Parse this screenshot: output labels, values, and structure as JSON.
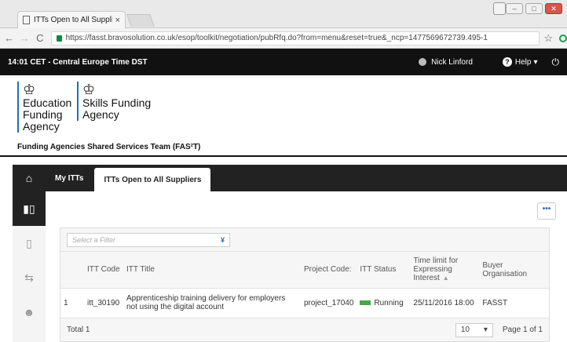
{
  "browser": {
    "tab_title": "ITTs Open to All Supplie",
    "tab_close": "×",
    "url": "https://fasst.bravosolution.co.uk/esop/toolkit/negotiation/pubRfq.do?from=menu&reset=true&_ncp=1477569672739.495-1",
    "back": "←",
    "forward": "→",
    "reload": "C",
    "star": "☆"
  },
  "topbar": {
    "time": "14:01 CET - Central Europe Time DST",
    "user_name": "Nick Linford",
    "help_label": "Help",
    "help_caret": "▾",
    "power": "⏻"
  },
  "header": {
    "logo1": [
      "Education",
      "Funding",
      "Agency"
    ],
    "logo2": [
      "Skills Funding",
      "Agency"
    ],
    "crest": "♔",
    "team_name": "Funding Agencies Shared Services Team (FAS²T)"
  },
  "tabs": [
    {
      "label": "My ITTs"
    },
    {
      "label": "ITTs Open to All Suppliers"
    }
  ],
  "content": {
    "more_label": "•••",
    "filter_placeholder": "Select a Filter",
    "filter_chevron": "¥",
    "columns": {
      "itt_code": "ITT Code",
      "itt_title": "ITT Title",
      "project_code": "Project Code:",
      "itt_status": "ITT Status",
      "time_limit": "Time limit for Expressing Interest",
      "buyer": "Buyer Organisation"
    },
    "rows": [
      {
        "num": "1",
        "code": "itt_30190",
        "title": "Apprenticeship training delivery for employers not using the digital account",
        "project": "project_17040",
        "status": "Running",
        "time_limit": "25/11/2016 18:00",
        "buyer": "FASST"
      }
    ],
    "total": "Total 1",
    "page_size": "10",
    "page_size_caret": "▾",
    "page_info": "Page 1 of 1"
  }
}
